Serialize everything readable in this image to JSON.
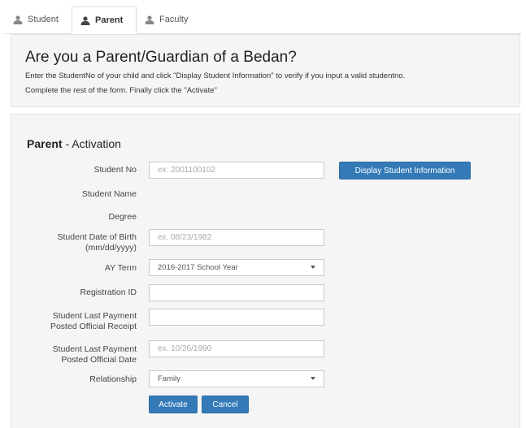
{
  "tabs": [
    {
      "label": "Student",
      "icon": "user-icon",
      "active": false
    },
    {
      "label": "Parent",
      "icon": "user-icon",
      "active": true
    },
    {
      "label": "Faculty",
      "icon": "user-icon",
      "active": false
    }
  ],
  "info": {
    "title": "Are you a Parent/Guardian of a Bedan?",
    "line1": "Enter the StudentNo of your child and click \"Display Student Information\" to verify if you input a valid studentno.",
    "line2": "Complete the rest of the form. Finally click the \"Activate\""
  },
  "form": {
    "title_bold": "Parent",
    "title_rest": " - Activation",
    "student_no": {
      "label": "Student No",
      "placeholder": "ex. 2001100102",
      "value": ""
    },
    "display_button": "Display Student Information",
    "student_name_label": "Student Name",
    "degree_label": "Degree",
    "dob": {
      "label_line1": "Student Date of Birth",
      "label_line2": "(mm/dd/yyyy)",
      "placeholder": "ex. 08/23/1982",
      "value": ""
    },
    "ay_term": {
      "label": "AY Term",
      "selected": "2016-2017 School Year"
    },
    "registration_id": {
      "label": "Registration ID",
      "value": ""
    },
    "receipt": {
      "label_line1": "Student Last Payment",
      "label_line2": "Posted Official Receipt",
      "value": ""
    },
    "official_date": {
      "label_line1": "Student Last Payment",
      "label_line2": "Posted Official Date",
      "placeholder": "ex. 10/26/1990",
      "value": ""
    },
    "relationship": {
      "label": "Relationship",
      "selected": "Family"
    },
    "activate_button": "Activate",
    "cancel_button": "Cancel"
  },
  "colors": {
    "primary": "#337ab7",
    "panel_bg": "#f5f5f5",
    "border": "#e3e3e3"
  }
}
